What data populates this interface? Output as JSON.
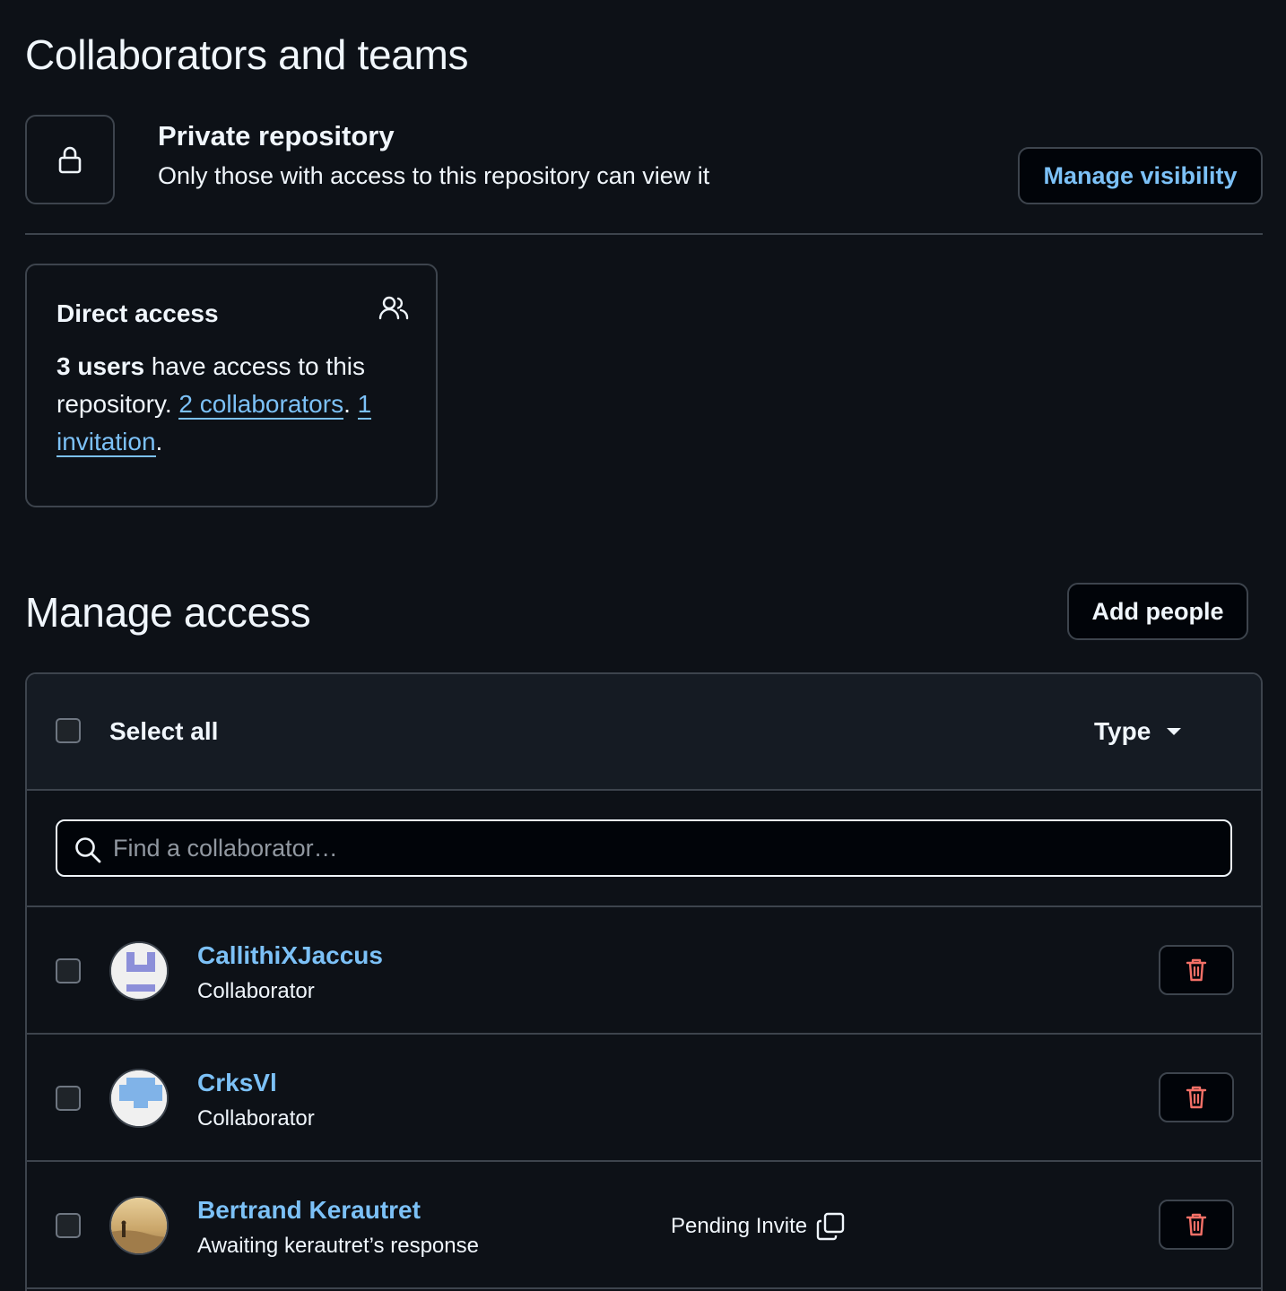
{
  "page_title": "Collaborators and teams",
  "visibility": {
    "title": "Private repository",
    "description": "Only those with access to this repository can view it",
    "button_label": "Manage visibility"
  },
  "direct_access": {
    "title": "Direct access",
    "count_bold": "3 users",
    "text_before": " have access to this repository. ",
    "collaborators_link": "2 collaborators",
    "separator": ". ",
    "invitation_link": "1 invitation",
    "text_after": "."
  },
  "manage_access": {
    "title": "Manage access",
    "add_button": "Add people",
    "select_all": "Select all",
    "type_filter": "Type",
    "search_placeholder": "Find a collaborator…"
  },
  "members": [
    {
      "name": "CallithiXJaccus",
      "role": "Collaborator",
      "pending": ""
    },
    {
      "name": "CrksVl",
      "role": "Collaborator",
      "pending": ""
    },
    {
      "name": "Bertrand Kerautret",
      "role": "Awaiting kerautret’s response",
      "pending": "Pending Invite"
    }
  ],
  "colors": {
    "background": "#0d1117",
    "link": "#7cc1f7",
    "border": "#3d444d",
    "danger": "#f47067"
  }
}
